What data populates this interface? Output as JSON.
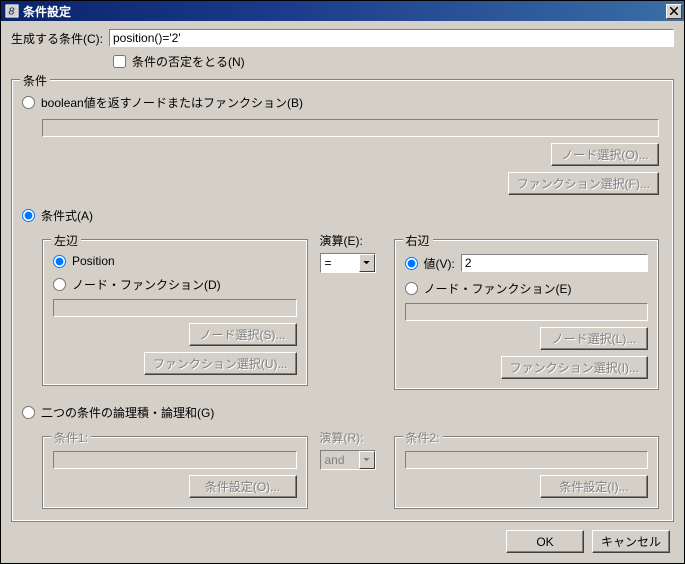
{
  "window": {
    "title": "条件設定"
  },
  "gen": {
    "label": "生成する条件(C):",
    "value": "position()='2'",
    "negate_label": "条件の否定をとる(N)"
  },
  "cond": {
    "legend": "条件",
    "opt_bool": "boolean値を返すノードまたはファンクション(B)",
    "bool_node_btn": "ノード選択(O)...",
    "bool_func_btn": "ファンクション選択(F)...",
    "opt_expr": "条件式(A)",
    "left": {
      "legend": "左辺",
      "opt_position": "Position",
      "opt_node_func": "ノード・ファンクション(D)",
      "node_btn": "ノード選択(S)...",
      "func_btn": "ファンクション選択(U)..."
    },
    "operator": {
      "label": "演算(E):",
      "value": "="
    },
    "right": {
      "legend": "右辺",
      "opt_value": "値(V):",
      "value_value": "2",
      "opt_node_func": "ノード・ファンクション(E)",
      "node_btn": "ノード選択(L)...",
      "func_btn": "ファンクション選択(I)..."
    },
    "opt_two": "二つの条件の論理積・論理和(G)",
    "two": {
      "c1_legend": "条件1:",
      "c1_btn": "条件設定(O)...",
      "op_label": "演算(R):",
      "op_value": "and",
      "c2_legend": "条件2:",
      "c2_btn": "条件設定(I)..."
    }
  },
  "buttons": {
    "ok": "OK",
    "cancel": "キャンセル"
  }
}
